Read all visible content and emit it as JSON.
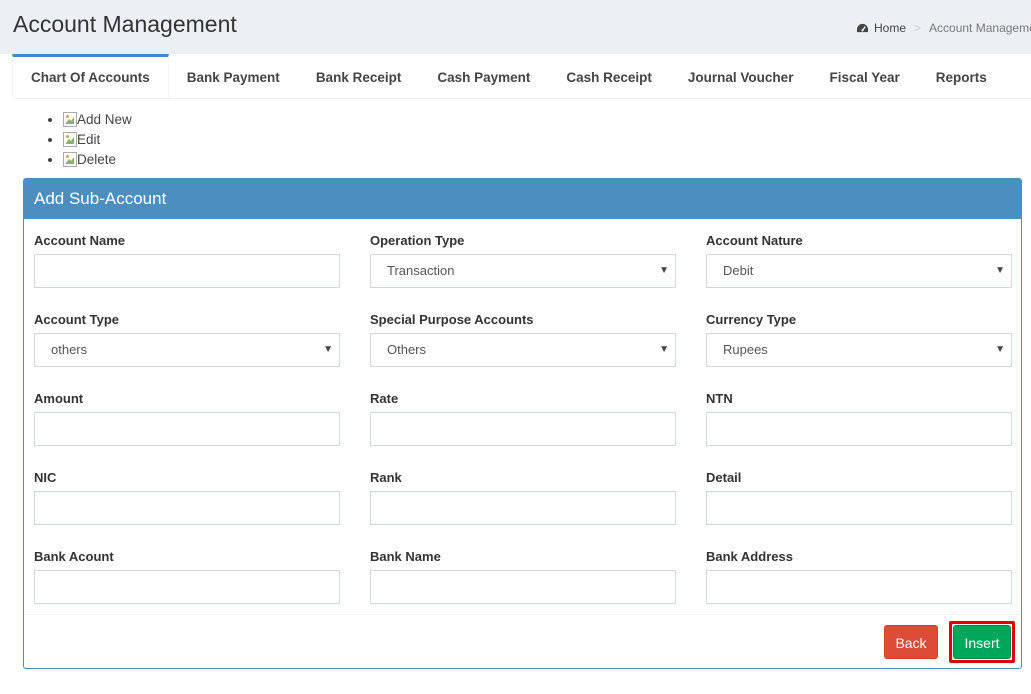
{
  "page": {
    "title": "Account Management"
  },
  "breadcrumb": {
    "home": "Home",
    "current": "Account Management"
  },
  "tabs": [
    {
      "label": "Chart Of Accounts",
      "active": true
    },
    {
      "label": "Bank Payment"
    },
    {
      "label": "Bank Receipt"
    },
    {
      "label": "Cash Payment"
    },
    {
      "label": "Cash Receipt"
    },
    {
      "label": "Journal Voucher"
    },
    {
      "label": "Fiscal Year"
    },
    {
      "label": "Reports"
    }
  ],
  "actions": {
    "add_new": "Add New",
    "edit": "Edit",
    "delete": "Delete"
  },
  "panel": {
    "title": "Add Sub-Account"
  },
  "form": {
    "account_name": {
      "label": "Account Name",
      "value": ""
    },
    "operation_type": {
      "label": "Operation Type",
      "value": "Transaction"
    },
    "account_nature": {
      "label": "Account Nature",
      "value": "Debit"
    },
    "account_type": {
      "label": "Account Type",
      "value": "others"
    },
    "special_purpose": {
      "label": "Special Purpose Accounts",
      "value": "Others"
    },
    "currency_type": {
      "label": "Currency Type",
      "value": "Rupees"
    },
    "amount": {
      "label": "Amount",
      "value": ""
    },
    "rate": {
      "label": "Rate",
      "value": ""
    },
    "ntn": {
      "label": "NTN",
      "value": ""
    },
    "nic": {
      "label": "NIC",
      "value": ""
    },
    "rank": {
      "label": "Rank",
      "value": ""
    },
    "detail": {
      "label": "Detail",
      "value": ""
    },
    "bank_account": {
      "label": "Bank Acount",
      "value": ""
    },
    "bank_name": {
      "label": "Bank Name",
      "value": ""
    },
    "bank_address": {
      "label": "Bank Address",
      "value": ""
    }
  },
  "buttons": {
    "back": "Back",
    "insert": "Insert"
  },
  "colors": {
    "primary": "#4a8fc0",
    "danger": "#dd4b39",
    "success": "#00a65a",
    "highlight": "#e00000"
  }
}
